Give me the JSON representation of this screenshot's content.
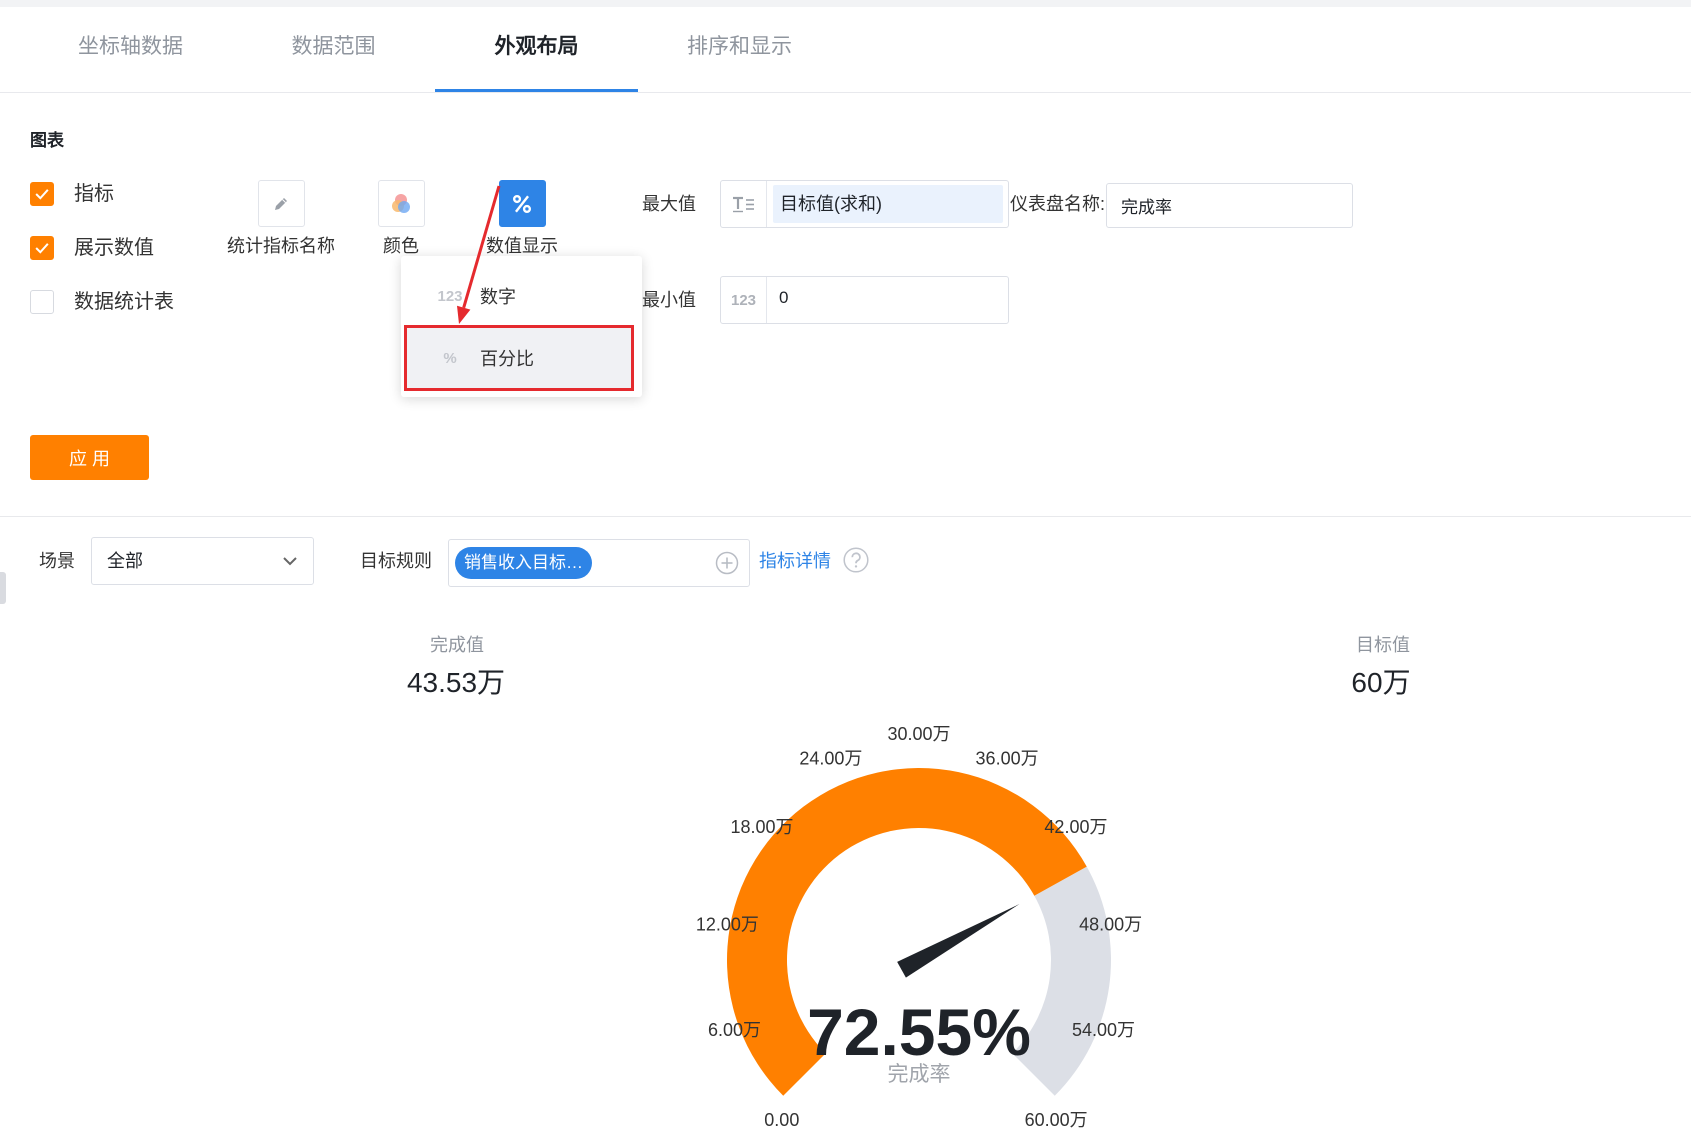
{
  "tabs": [
    {
      "label": "坐标轴数据",
      "active": false
    },
    {
      "label": "数据范围",
      "active": false
    },
    {
      "label": "外观布局",
      "active": true
    },
    {
      "label": "排序和显示",
      "active": false
    }
  ],
  "chart_panel": {
    "title": "图表",
    "options": [
      {
        "label": "指标",
        "checked": true
      },
      {
        "label": "展示数值",
        "checked": true
      },
      {
        "label": "数据统计表",
        "checked": false
      }
    ],
    "tools": [
      {
        "label": "统计指标名称",
        "icon": "pencil-icon",
        "active": false
      },
      {
        "label": "颜色",
        "icon": "palette-icon",
        "active": false
      },
      {
        "label": "数值显示",
        "icon": "percent-icon",
        "active": true
      }
    ],
    "value_display_menu": [
      {
        "icon_text": "123",
        "label": "数字",
        "highlighted": false
      },
      {
        "icon_text": "%",
        "label": "百分比",
        "highlighted": true
      }
    ],
    "max_field": {
      "label": "最大值",
      "icon": "text-field-icon",
      "value": "目标值(求和)"
    },
    "min_field": {
      "label": "最小值",
      "icon_text": "123",
      "value": "0"
    },
    "gauge_name_field": {
      "label": "仪表盘名称:",
      "value": "完成率"
    },
    "apply_label": "应 用"
  },
  "filters": {
    "scene_label": "场景",
    "scene_value": "全部",
    "rule_label": "目标规则",
    "rule_chip": "销售收入目标…",
    "add_icon": "plus-circle-icon",
    "detail_link": "指标详情",
    "help_icon": "question-circle-icon"
  },
  "gauge": {
    "completed_label": "完成值",
    "completed_value": "43.53万",
    "target_label": "目标值",
    "target_value": "60万",
    "center_value": "72.55%",
    "center_label": "完成率"
  },
  "colors": {
    "accent": "#ff8000",
    "primary": "#2e84e6",
    "track": "#dcdfe6",
    "annotation": "#e52a2e",
    "pointer": "#1f2329"
  },
  "chart_data": {
    "type": "gauge",
    "min": 0,
    "max": 60,
    "value": 43.53,
    "axis_labels": [
      "0.00",
      "6.00万",
      "12.00万",
      "18.00万",
      "24.00万",
      "30.00万",
      "36.00万",
      "42.00万",
      "48.00万",
      "54.00万",
      "60.00万"
    ]
  }
}
